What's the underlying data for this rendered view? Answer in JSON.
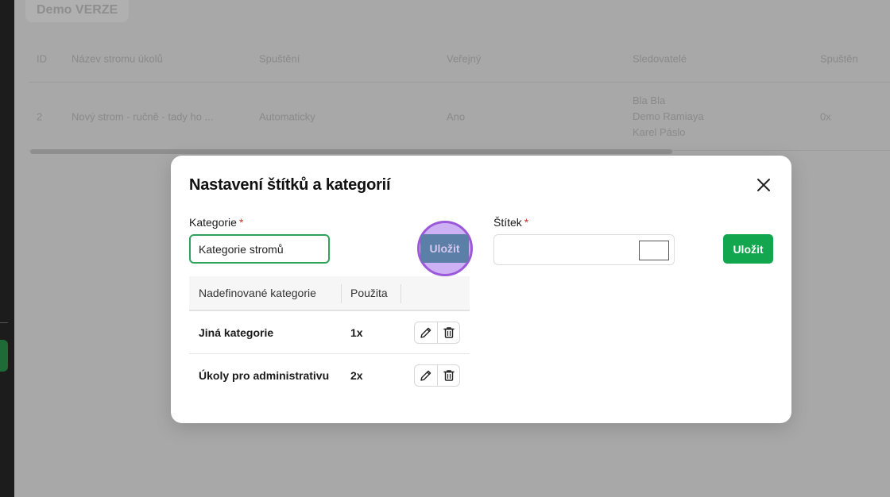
{
  "background": {
    "chip_label": "Demo VERZE",
    "table_headers": [
      "ID",
      "Název stromu úkolů",
      "Spuštění",
      "Veřejný",
      "Sledovatelé",
      "Spuštěn"
    ],
    "table_row": {
      "id": "2",
      "name": "Nový strom - ručně - tady ho ...",
      "start": "Automaticky",
      "public": "Ano",
      "followers": [
        "Bla Bla",
        "Demo Ramiaya",
        "Karel Páslo"
      ],
      "launched": "0x"
    }
  },
  "modal": {
    "title": "Nastavení štítků a kategorií",
    "category": {
      "label": "Kategorie",
      "required_mark": "*",
      "input_value": "Kategorie stromů",
      "save_label": "Uložit",
      "table": {
        "headers": [
          "Nadefinované kategorie",
          "Použita"
        ],
        "rows": [
          {
            "name": "Jiná kategorie",
            "count": "1x"
          },
          {
            "name": "Úkoly pro administrativu",
            "count": "2x"
          }
        ]
      }
    },
    "tag": {
      "label": "Štítek",
      "required_mark": "*",
      "input_value": "",
      "color_value": "#ffffff",
      "save_label": "Uložit"
    }
  },
  "colors": {
    "primary_green": "#12a74f",
    "focus_green": "#2fa35a",
    "highlight_purple": "#9b59d9",
    "required_red": "#d0342c"
  }
}
